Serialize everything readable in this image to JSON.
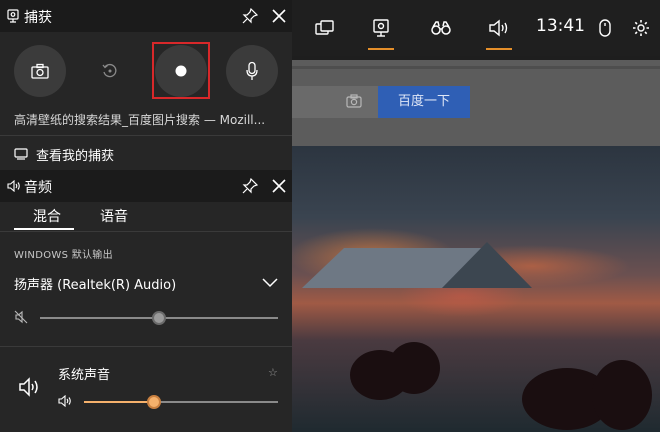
{
  "toolbar": {
    "clock": "13:41",
    "accent": "#e58f2a",
    "icons": [
      "widget-menu-icon",
      "capture-icon",
      "performance-icon",
      "audio-icon",
      "mouse-icon",
      "settings-icon"
    ]
  },
  "capture": {
    "title": "捕获",
    "window_title": "高清壁纸的搜索结果_百度图片搜索 — Mozill...",
    "view_captures": "查看我的捕获",
    "record_highlight_color": "#d8282a"
  },
  "audio": {
    "title": "音频",
    "tabs": [
      {
        "label": "混合",
        "active": true
      },
      {
        "label": "语音",
        "active": false
      }
    ],
    "section_label": "WINDOWS 默认输出",
    "device": "扬声器 (Realtek(R) Audio)",
    "device_volume": 0.5,
    "system_sound_label": "系统声音",
    "system_volume": 0.36,
    "slider_color": "#f5b16c"
  },
  "browser": {
    "search_button": "百度一下"
  }
}
